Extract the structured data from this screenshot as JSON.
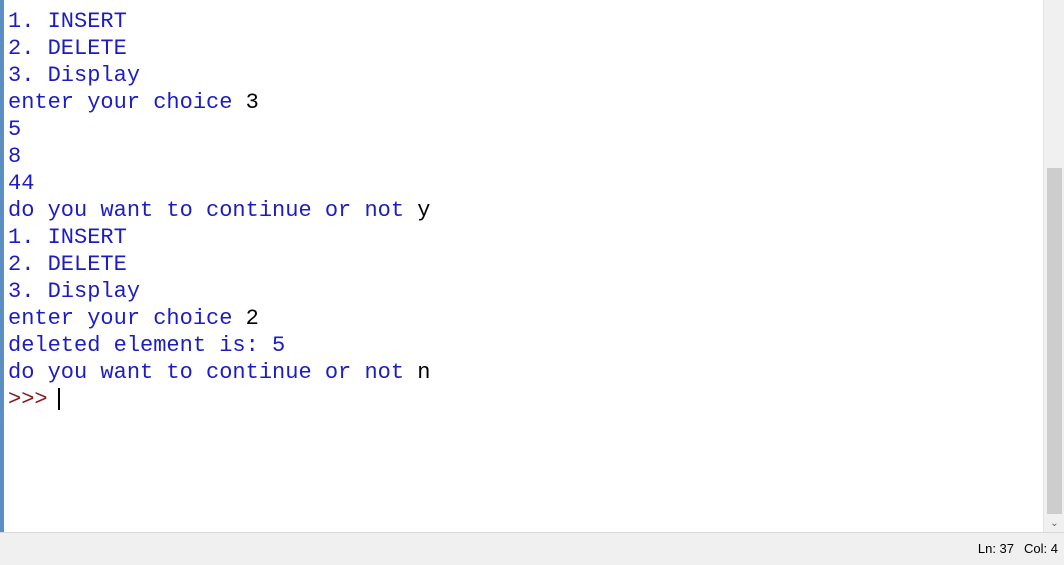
{
  "shell": {
    "lines": [
      {
        "text": "1. INSERT",
        "input": ""
      },
      {
        "text": "2. DELETE",
        "input": ""
      },
      {
        "text": "3. Display",
        "input": ""
      },
      {
        "text": "enter your choice ",
        "input": "3"
      },
      {
        "text": "5",
        "input": ""
      },
      {
        "text": "8",
        "input": ""
      },
      {
        "text": "44",
        "input": ""
      },
      {
        "text": "do you want to continue or not ",
        "input": "y"
      },
      {
        "text": "1. INSERT",
        "input": ""
      },
      {
        "text": "2. DELETE",
        "input": ""
      },
      {
        "text": "3. Display",
        "input": ""
      },
      {
        "text": "enter your choice ",
        "input": "2"
      },
      {
        "text": "deleted element is: 5",
        "input": ""
      },
      {
        "text": "do you want to continue or not ",
        "input": "n"
      }
    ],
    "prompt": ">>>"
  },
  "status_bar": {
    "line": "Ln: 37",
    "col": "Col: 4"
  },
  "icons": {
    "scroll_down": "chevron-down-icon"
  },
  "colors": {
    "output_text": "#1c1cc4",
    "user_input": "#000000",
    "prompt": "#8b1a1a",
    "window_border": "#5b8ec2"
  }
}
